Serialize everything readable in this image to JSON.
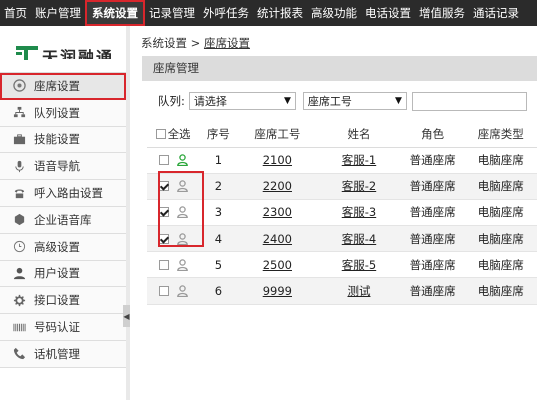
{
  "topnav": {
    "items": [
      "首页",
      "账户管理",
      "系统设置",
      "记录管理",
      "外呼任务",
      "统计报表",
      "高级功能",
      "电话设置",
      "增值服务",
      "通话记录"
    ],
    "active_index": 2
  },
  "sidebar": {
    "logo_text": "天润融通",
    "items": [
      {
        "label": "座席设置",
        "icon": "headset-icon",
        "active": true
      },
      {
        "label": "队列设置",
        "icon": "org-chart-icon"
      },
      {
        "label": "技能设置",
        "icon": "briefcase-icon"
      },
      {
        "label": "语音导航",
        "icon": "microphone-icon"
      },
      {
        "label": "呼入路由设置",
        "icon": "phone-icon"
      },
      {
        "label": "企业语音库",
        "icon": "cube-icon"
      },
      {
        "label": "高级设置",
        "icon": "clock-icon"
      },
      {
        "label": "用户设置",
        "icon": "user-icon"
      },
      {
        "label": "接口设置",
        "icon": "gear-icon"
      },
      {
        "label": "号码认证",
        "icon": "barcode-icon"
      },
      {
        "label": "话机管理",
        "icon": "handset-icon"
      }
    ]
  },
  "breadcrumb": {
    "root": "系统设置",
    "separator": " > ",
    "current": "座席设置"
  },
  "section_title": "座席管理",
  "filter": {
    "queue_label": "队列:",
    "queue_select": "请选择",
    "field_select": "座席工号",
    "search_value": ""
  },
  "table": {
    "headers": {
      "select_all": "全选",
      "index": "序号",
      "agent_id": "座席工号",
      "name": "姓名",
      "role": "角色",
      "type": "座席类型"
    },
    "rows": [
      {
        "checked": false,
        "online": true,
        "index": "1",
        "agent_id": "2100",
        "name": "客服-1",
        "role": "普通座席",
        "type": "电脑座席"
      },
      {
        "checked": true,
        "online": false,
        "index": "2",
        "agent_id": "2200",
        "name": "客服-2",
        "role": "普通座席",
        "type": "电脑座席"
      },
      {
        "checked": true,
        "online": false,
        "index": "3",
        "agent_id": "2300",
        "name": "客服-3",
        "role": "普通座席",
        "type": "电脑座席"
      },
      {
        "checked": true,
        "online": false,
        "index": "4",
        "agent_id": "2400",
        "name": "客服-4",
        "role": "普通座席",
        "type": "电脑座席"
      },
      {
        "checked": false,
        "online": false,
        "index": "5",
        "agent_id": "2500",
        "name": "客服-5",
        "role": "普通座席",
        "type": "电脑座席"
      },
      {
        "checked": false,
        "online": false,
        "index": "6",
        "agent_id": "9999",
        "name": "测试",
        "role": "普通座席",
        "type": "电脑座席"
      }
    ]
  },
  "colors": {
    "accent_red": "#d8262c",
    "online_green": "#2aa63a",
    "offline_gray": "#9a9a9a",
    "nav_bg": "#2b2b2b"
  }
}
